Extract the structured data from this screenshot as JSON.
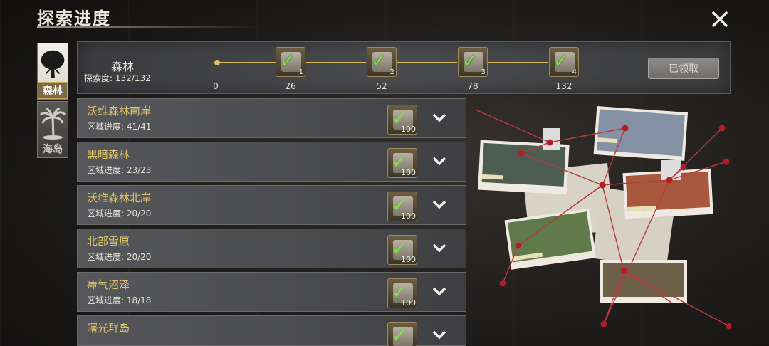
{
  "title": "探索进度",
  "tabs": [
    {
      "label": "森林",
      "active": true
    },
    {
      "label": "海岛",
      "active": false
    }
  ],
  "summary": {
    "name": "森林",
    "explore_label": "探索度: 132/132",
    "milestones": [
      "1",
      "2",
      "3",
      "4"
    ],
    "ticks": [
      "0",
      "26",
      "52",
      "78",
      "132"
    ],
    "claim_button": "已领取"
  },
  "rows": [
    {
      "name": "沃维森林南岸",
      "progress": "区域进度: 41/41",
      "percent": "100"
    },
    {
      "name": "黑暗森林",
      "progress": "区域进度: 23/23",
      "percent": "100"
    },
    {
      "name": "沃维森林北岸",
      "progress": "区域进度: 20/20",
      "percent": "100"
    },
    {
      "name": "北部雪原",
      "progress": "区域进度: 20/20",
      "percent": "100"
    },
    {
      "name": "瘴气沼泽",
      "progress": "区域进度: 18/18",
      "percent": "100"
    },
    {
      "name": "曙光群岛",
      "progress": "",
      "percent": ""
    }
  ],
  "colors": {
    "accent_gold": "#e0c46a",
    "check_green": "#7fe04a",
    "track": "#d8b854",
    "pin_red": "#b01e28"
  }
}
